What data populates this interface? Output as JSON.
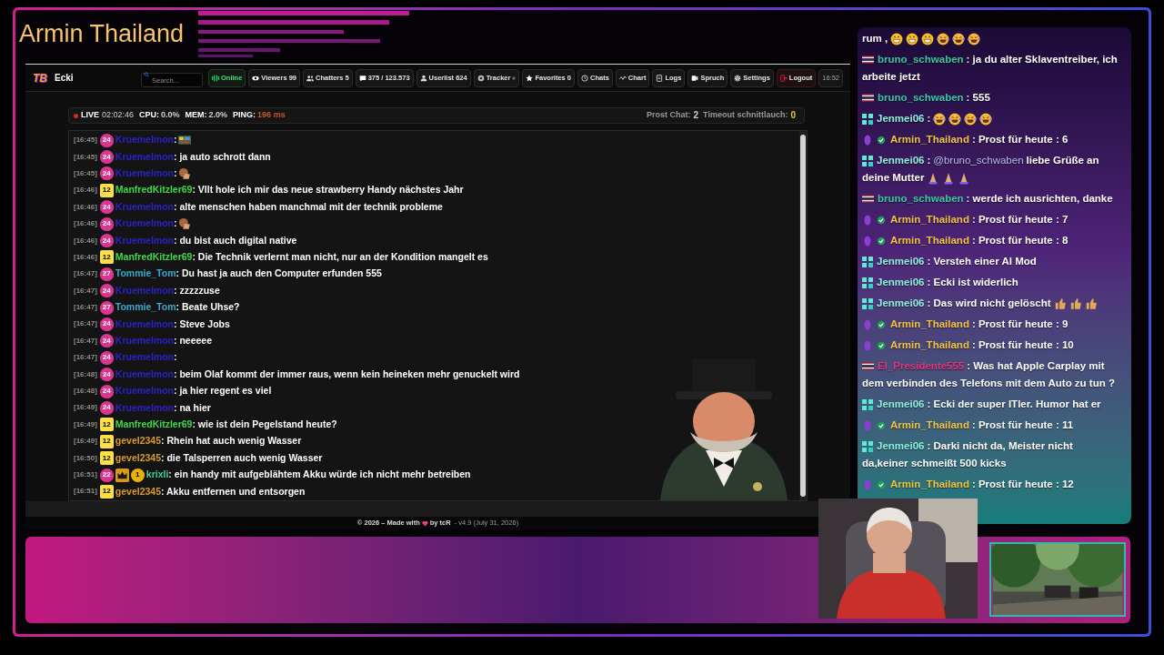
{
  "overlay": {
    "title": "Armin Thailand"
  },
  "app": {
    "logo": "TB",
    "title": "Ecki",
    "search": {
      "placeholder": "Search..."
    },
    "toolbar": [
      {
        "kind": "online",
        "label": "Online"
      },
      {
        "kind": "viewers",
        "label": "Viewers",
        "count": "99"
      },
      {
        "kind": "chatters",
        "label": "Chatters",
        "count": "5"
      },
      {
        "kind": "messages",
        "label": "375 / 123.573"
      },
      {
        "kind": "userlist",
        "label": "Userlist",
        "count": "624"
      },
      {
        "kind": "tracker",
        "label": "Tracker"
      },
      {
        "kind": "favorites",
        "label": "Favorites",
        "count": "0"
      },
      {
        "kind": "chats",
        "label": "Chats"
      },
      {
        "kind": "chart",
        "label": "Chart"
      },
      {
        "kind": "logs",
        "label": "Logs"
      },
      {
        "kind": "spruch",
        "label": "Spruch"
      },
      {
        "kind": "settings",
        "label": "Settings"
      },
      {
        "kind": "logout",
        "label": "Logout"
      }
    ],
    "clock": "16:52"
  },
  "stats": {
    "live": "LIVE",
    "uptime": "02:02:46",
    "metrics": [
      {
        "label": "CPU:",
        "value": "0.0%",
        "color": "#d0d0d0"
      },
      {
        "label": "MEM:",
        "value": "2.0%",
        "color": "#d0d0d0"
      },
      {
        "label": "PING:",
        "value": "196 ms",
        "color": "#c2582c"
      }
    ],
    "counters": [
      {
        "label": "Prost Chat:",
        "value": "2",
        "color": "#d0d0d0"
      },
      {
        "label": "Timeout schnittlauch:",
        "value": "0",
        "color": "#e5c93a"
      }
    ]
  },
  "chat": {
    "messages": [
      {
        "time": "[16:45]",
        "badges": [
          {
            "kind": "sub",
            "label": "24"
          }
        ],
        "user": "Kruemelmon",
        "color": "#2b22c4",
        "parts": [
          {
            "kind": "text",
            "text": ":"
          },
          {
            "kind": "pixel"
          }
        ]
      },
      {
        "time": "[16:45]",
        "badges": [
          {
            "kind": "sub",
            "label": "24"
          }
        ],
        "user": "Kruemelmon",
        "color": "#2b22c4",
        "parts": [
          {
            "kind": "text",
            "text": ": ja auto schrott dann"
          }
        ]
      },
      {
        "time": "[16:45]",
        "badges": [
          {
            "kind": "sub",
            "label": "24"
          }
        ],
        "user": "Kruemelmon",
        "color": "#2b22c4",
        "parts": [
          {
            "kind": "text",
            "text": ":"
          },
          {
            "kind": "facepalm"
          }
        ]
      },
      {
        "time": "[16:46]",
        "badges": [
          {
            "kind": "level",
            "label": "12"
          }
        ],
        "user": "ManfredKitzler69",
        "color": "#3fd84a",
        "parts": [
          {
            "kind": "text",
            "text": ": Vllt hole ich mir das neue strawberry Handy nächstes Jahr"
          }
        ]
      },
      {
        "time": "[16:46]",
        "badges": [
          {
            "kind": "sub",
            "label": "24"
          }
        ],
        "user": "Kruemelmon",
        "color": "#2b22c4",
        "parts": [
          {
            "kind": "text",
            "text": ": alte menschen haben manchmal mit der technik probleme"
          }
        ]
      },
      {
        "time": "[16:46]",
        "badges": [
          {
            "kind": "sub",
            "label": "24"
          }
        ],
        "user": "Kruemelmon",
        "color": "#2b22c4",
        "parts": [
          {
            "kind": "text",
            "text": ":"
          },
          {
            "kind": "facepalm"
          }
        ]
      },
      {
        "time": "[16:46]",
        "badges": [
          {
            "kind": "sub",
            "label": "24"
          }
        ],
        "user": "Kruemelmon",
        "color": "#2b22c4",
        "parts": [
          {
            "kind": "text",
            "text": ": du bist auch digital native"
          }
        ]
      },
      {
        "time": "[16:46]",
        "badges": [
          {
            "kind": "level",
            "label": "12"
          }
        ],
        "user": "ManfredKitzler69",
        "color": "#3fd84a",
        "parts": [
          {
            "kind": "text",
            "text": ": Die Technik verlernt man nicht, nur an der Kondition mangelt es"
          }
        ]
      },
      {
        "time": "[16:47]",
        "badges": [
          {
            "kind": "sub",
            "label": "27"
          }
        ],
        "user": "Tommie_Tom",
        "color": "#3aa8d0",
        "parts": [
          {
            "kind": "text",
            "text": ": Du hast ja auch den Computer erfunden 555"
          }
        ]
      },
      {
        "time": "[16:47]",
        "badges": [
          {
            "kind": "sub",
            "label": "24"
          }
        ],
        "user": "Kruemelmon",
        "color": "#2b22c4",
        "parts": [
          {
            "kind": "text",
            "text": ": zzzzzuse"
          }
        ]
      },
      {
        "time": "[16:47]",
        "badges": [
          {
            "kind": "sub",
            "label": "27"
          }
        ],
        "user": "Tommie_Tom",
        "color": "#3aa8d0",
        "parts": [
          {
            "kind": "text",
            "text": ": Beate Uhse?"
          }
        ]
      },
      {
        "time": "[16:47]",
        "badges": [
          {
            "kind": "sub",
            "label": "24"
          }
        ],
        "user": "Kruemelmon",
        "color": "#2b22c4",
        "parts": [
          {
            "kind": "text",
            "text": ": Steve Jobs"
          }
        ]
      },
      {
        "time": "[16:47]",
        "badges": [
          {
            "kind": "sub",
            "label": "24"
          }
        ],
        "user": "Kruemelmon",
        "color": "#2b22c4",
        "parts": [
          {
            "kind": "text",
            "text": ": neeeee"
          }
        ]
      },
      {
        "time": "[16:47]",
        "badges": [
          {
            "kind": "sub",
            "label": "24"
          }
        ],
        "user": "Kruemelmon",
        "color": "#2b22c4",
        "parts": [
          {
            "kind": "text",
            "text": ":"
          }
        ]
      },
      {
        "time": "[16:48]",
        "badges": [
          {
            "kind": "sub",
            "label": "24"
          }
        ],
        "user": "Kruemelmon",
        "color": "#2b22c4",
        "parts": [
          {
            "kind": "text",
            "text": ": beim Olaf kommt der immer raus, wenn kein heineken mehr genuckelt wird"
          }
        ]
      },
      {
        "time": "[16:48]",
        "badges": [
          {
            "kind": "sub",
            "label": "24"
          }
        ],
        "user": "Kruemelmon",
        "color": "#2b22c4",
        "parts": [
          {
            "kind": "text",
            "text": ": ja hier regent es viel"
          }
        ]
      },
      {
        "time": "[16:49]",
        "badges": [
          {
            "kind": "sub",
            "label": "24"
          }
        ],
        "user": "Kruemelmon",
        "color": "#2b22c4",
        "parts": [
          {
            "kind": "text",
            "text": ": na hier"
          }
        ]
      },
      {
        "time": "[16:49]",
        "badges": [
          {
            "kind": "level",
            "label": "12"
          }
        ],
        "user": "ManfredKitzler69",
        "color": "#3fd84a",
        "parts": [
          {
            "kind": "text",
            "text": ": wie ist dein Pegelstand heute?"
          }
        ]
      },
      {
        "time": "[16:49]",
        "badges": [
          {
            "kind": "level",
            "label": "12"
          }
        ],
        "user": "gevel2345",
        "color": "#d99a2b",
        "parts": [
          {
            "kind": "text",
            "text": ": Rhein hat auch wenig Wasser"
          }
        ]
      },
      {
        "time": "[16:50]",
        "badges": [
          {
            "kind": "level",
            "label": "12"
          }
        ],
        "user": "gevel2345",
        "color": "#d99a2b",
        "parts": [
          {
            "kind": "text",
            "text": ": die Talsperren auch wenig Wasser"
          }
        ]
      },
      {
        "time": "[16:51]",
        "badges": [
          {
            "kind": "sub",
            "label": "22"
          },
          {
            "kind": "crown"
          },
          {
            "kind": "rank",
            "label": "1"
          }
        ],
        "user": "krixli",
        "color": "#34d39a",
        "parts": [
          {
            "kind": "text",
            "text": ": ein handy mit aufgeblähtem Akku würde ich nicht mehr betreiben"
          }
        ]
      },
      {
        "time": "[16:51]",
        "badges": [
          {
            "kind": "level",
            "label": "12"
          }
        ],
        "user": "gevel2345",
        "color": "#d99a2b",
        "parts": [
          {
            "kind": "text",
            "text": ": Akku entfernen und entsorgen"
          }
        ]
      }
    ]
  },
  "footer": {
    "lead": "© 2026 – Made with",
    "credit": "by tcR",
    "version": "- v4.9 (July 31, 2026)"
  },
  "side_chat": {
    "messages": [
      {
        "parts": [
          {
            "kind": "text",
            "text": "rum ,"
          },
          {
            "kind": "grin"
          },
          {
            "kind": "grin"
          },
          {
            "kind": "grin"
          },
          {
            "kind": "laugh"
          },
          {
            "kind": "laugh"
          },
          {
            "kind": "laugh"
          }
        ]
      },
      {
        "prefix": [
          {
            "kind": "flag"
          }
        ],
        "user": "bruno_schwaben",
        "color": "#3cc8a2",
        "parts": [
          {
            "kind": "text",
            "text": ": ja du alter Sklaventreiber, ich"
          },
          {
            "kind": "wrapped",
            "text": "arbeite jetzt"
          }
        ]
      },
      {
        "prefix": [
          {
            "kind": "flag"
          }
        ],
        "user": "bruno_schwaben",
        "color": "#3cc8a2",
        "parts": [
          {
            "kind": "text",
            "text": ": 555"
          }
        ]
      },
      {
        "prefix": [
          {
            "kind": "grid"
          }
        ],
        "user": "Jenmei06",
        "color": "#8ff0dc",
        "parts": [
          {
            "kind": "text",
            "text": ":"
          },
          {
            "kind": "laugh"
          },
          {
            "kind": "laugh"
          },
          {
            "kind": "laugh"
          },
          {
            "kind": "laugh"
          }
        ]
      },
      {
        "prefix": [
          {
            "kind": "gem"
          },
          {
            "kind": "check"
          }
        ],
        "user": "Armin_Thailand",
        "color": "#f2c444",
        "parts": [
          {
            "kind": "text",
            "text": ": Prost für heute : 6"
          }
        ]
      },
      {
        "prefix": [
          {
            "kind": "grid"
          }
        ],
        "user": "Jenmei06",
        "color": "#8ff0dc",
        "parts": [
          {
            "kind": "text",
            "text": ":"
          },
          {
            "kind": "mention",
            "text": "@bruno_schwaben"
          },
          {
            "kind": "text",
            "text": "liebe Grüße an"
          },
          {
            "kind": "wrapped",
            "text": "deine Mutter"
          },
          {
            "kind": "pray"
          },
          {
            "kind": "pray"
          },
          {
            "kind": "pray"
          }
        ]
      },
      {
        "prefix": [
          {
            "kind": "flag"
          }
        ],
        "user": "bruno_schwaben",
        "color": "#3cc8a2",
        "parts": [
          {
            "kind": "text",
            "text": ": werde ich ausrichten, danke"
          }
        ]
      },
      {
        "prefix": [
          {
            "kind": "gem"
          },
          {
            "kind": "check"
          }
        ],
        "user": "Armin_Thailand",
        "color": "#f2c444",
        "parts": [
          {
            "kind": "text",
            "text": ": Prost für heute : 7"
          }
        ]
      },
      {
        "prefix": [
          {
            "kind": "gem"
          },
          {
            "kind": "check"
          }
        ],
        "user": "Armin_Thailand",
        "color": "#f2c444",
        "parts": [
          {
            "kind": "text",
            "text": ": Prost für heute : 8"
          }
        ]
      },
      {
        "prefix": [
          {
            "kind": "grid"
          }
        ],
        "user": "Jenmei06",
        "color": "#8ff0dc",
        "parts": [
          {
            "kind": "text",
            "text": ": Versteh einer AI Mod"
          }
        ]
      },
      {
        "prefix": [
          {
            "kind": "grid"
          }
        ],
        "user": "Jenmei06",
        "color": "#8ff0dc",
        "parts": [
          {
            "kind": "text",
            "text": ": Ecki ist widerlich"
          }
        ]
      },
      {
        "prefix": [
          {
            "kind": "grid"
          }
        ],
        "user": "Jenmei06",
        "color": "#8ff0dc",
        "parts": [
          {
            "kind": "text",
            "text": ": Das wird nicht gelöscht"
          },
          {
            "kind": "thumb"
          },
          {
            "kind": "thumb"
          },
          {
            "kind": "thumb"
          }
        ]
      },
      {
        "prefix": [
          {
            "kind": "gem"
          },
          {
            "kind": "check"
          }
        ],
        "user": "Armin_Thailand",
        "color": "#f2c444",
        "parts": [
          {
            "kind": "text",
            "text": ": Prost für heute : 9"
          }
        ]
      },
      {
        "prefix": [
          {
            "kind": "gem"
          },
          {
            "kind": "check"
          }
        ],
        "user": "Armin_Thailand",
        "color": "#f2c444",
        "parts": [
          {
            "kind": "text",
            "text": ": Prost für heute : 10"
          }
        ]
      },
      {
        "prefix": [
          {
            "kind": "flag"
          }
        ],
        "user": "El_Presidente555",
        "color": "#e0387e",
        "parts": [
          {
            "kind": "text",
            "text": ": Was hat Apple Carplay mit"
          },
          {
            "kind": "wrapped",
            "text": "dem verbinden des Telefons mit dem Auto zu tun ?"
          }
        ]
      },
      {
        "prefix": [
          {
            "kind": "grid"
          }
        ],
        "user": "Jenmei06",
        "color": "#8ff0dc",
        "parts": [
          {
            "kind": "text",
            "text": ": Ecki der super ITler. Humor hat er"
          }
        ]
      },
      {
        "prefix": [
          {
            "kind": "gem"
          },
          {
            "kind": "check"
          }
        ],
        "user": "Armin_Thailand",
        "color": "#f2c444",
        "parts": [
          {
            "kind": "text",
            "text": ": Prost für heute : 11"
          }
        ]
      },
      {
        "prefix": [
          {
            "kind": "grid"
          }
        ],
        "user": "Jenmei06",
        "color": "#8ff0dc",
        "parts": [
          {
            "kind": "text",
            "text": ": Darki nicht da, Meister nicht"
          },
          {
            "kind": "wrapped",
            "text": "da,keiner schmeißt 500 kicks"
          }
        ]
      },
      {
        "prefix": [
          {
            "kind": "gem"
          },
          {
            "kind": "check"
          }
        ],
        "user": "Armin_Thailand",
        "color": "#f2c444",
        "parts": [
          {
            "kind": "text",
            "text": ": Prost für heute : 12"
          }
        ]
      }
    ]
  }
}
